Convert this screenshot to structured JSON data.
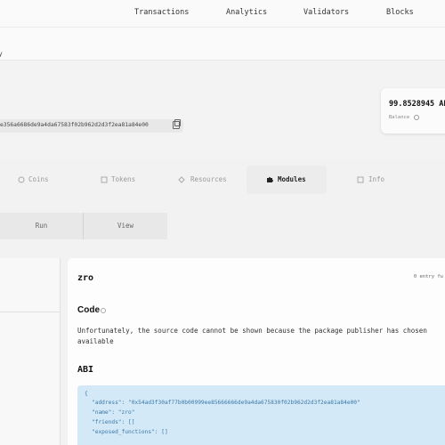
{
  "nav": {
    "items": [
      "Transactions",
      "Analytics",
      "Validators",
      "Blocks"
    ]
  },
  "breadcrumb": "y",
  "account": {
    "address": "e356a6686de9a4da67583f02b962d2d3f2ea81a84e00",
    "balance": "99.8528945 AP",
    "balance_label": "Balance"
  },
  "tabs": [
    {
      "label": "Coins",
      "icon": "coins-icon"
    },
    {
      "label": "Tokens",
      "icon": "tokens-icon"
    },
    {
      "label": "Resources",
      "icon": "resources-icon"
    },
    {
      "label": "Modules",
      "icon": "puzzle-icon",
      "active": true
    },
    {
      "label": "Info",
      "icon": "info-icon"
    }
  ],
  "sub_tabs": [
    {
      "label": "Run"
    },
    {
      "label": "View"
    }
  ],
  "module": {
    "name": "zro",
    "entry_count": "0 entry fu",
    "code_title": "Code",
    "code_message": "Unfortunately, the source code cannot be shown because the package publisher has chosen",
    "code_message_2": "available",
    "abi_title": "ABI",
    "abi_lines": [
      "{",
      "\"address\": \"0x54ad3f30af77b0b00999ee85666666de9a4da675830f02b962d2d3f2ea81a84e00\"",
      "\"name\": \"zro\"",
      "\"friends\": []",
      "\"exposed_functions\": []"
    ]
  },
  "colors": {
    "accent": "#3c78a8",
    "abi_bg": "#d3e9f7"
  }
}
